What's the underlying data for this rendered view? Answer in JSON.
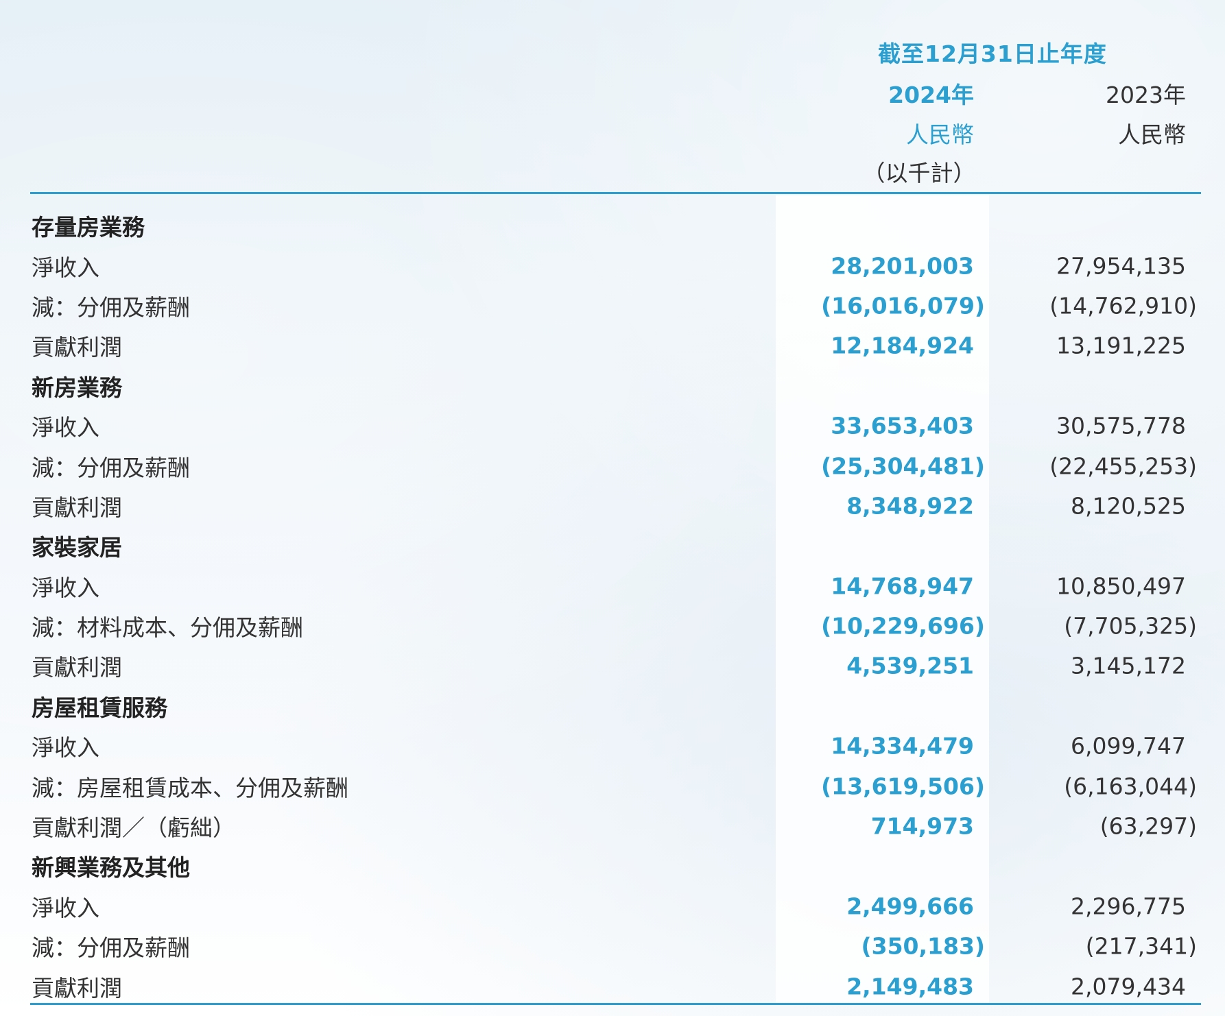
{
  "header": {
    "period": "截至12月31日止年度",
    "year_2024": "2024年",
    "year_2023": "2023年",
    "currency_2024": "人民幣",
    "currency_2023": "人民幣",
    "unit": "（以千計）"
  },
  "colors": {
    "accent": "#2c9fd1",
    "text": "#333333"
  },
  "rows": [
    {
      "label": "存量房業務",
      "section": true,
      "v2024": "",
      "v2023": ""
    },
    {
      "label": "淨收入",
      "section": false,
      "v2024": "28,201,003",
      "v2023": "27,954,135"
    },
    {
      "label": "減：分佣及薪酬",
      "section": false,
      "v2024": "(16,016,079)",
      "v2023": "(14,762,910)"
    },
    {
      "label": "貢獻利潤",
      "section": false,
      "v2024": "12,184,924",
      "v2023": "13,191,225"
    },
    {
      "label": "新房業務",
      "section": true,
      "v2024": "",
      "v2023": ""
    },
    {
      "label": "淨收入",
      "section": false,
      "v2024": "33,653,403",
      "v2023": "30,575,778"
    },
    {
      "label": "減：分佣及薪酬",
      "section": false,
      "v2024": "(25,304,481)",
      "v2023": "(22,455,253)"
    },
    {
      "label": "貢獻利潤",
      "section": false,
      "v2024": "8,348,922",
      "v2023": "8,120,525"
    },
    {
      "label": "家裝家居",
      "section": true,
      "v2024": "",
      "v2023": ""
    },
    {
      "label": "淨收入",
      "section": false,
      "v2024": "14,768,947",
      "v2023": "10,850,497"
    },
    {
      "label": "減：材料成本、分佣及薪酬",
      "section": false,
      "v2024": "(10,229,696)",
      "v2023": "(7,705,325)"
    },
    {
      "label": "貢獻利潤",
      "section": false,
      "v2024": "4,539,251",
      "v2023": "3,145,172"
    },
    {
      "label": "房屋租賃服務",
      "section": true,
      "v2024": "",
      "v2023": ""
    },
    {
      "label": "淨收入",
      "section": false,
      "v2024": "14,334,479",
      "v2023": "6,099,747"
    },
    {
      "label": "減：房屋租賃成本、分佣及薪酬",
      "section": false,
      "v2024": "(13,619,506)",
      "v2023": "(6,163,044)"
    },
    {
      "label": "貢獻利潤／（虧絀）",
      "section": false,
      "v2024": "714,973",
      "v2023": "(63,297)"
    },
    {
      "label": "新興業務及其他",
      "section": true,
      "v2024": "",
      "v2023": ""
    },
    {
      "label": "淨收入",
      "section": false,
      "v2024": "2,499,666",
      "v2023": "2,296,775"
    },
    {
      "label": "減：分佣及薪酬",
      "section": false,
      "v2024": "(350,183)",
      "v2023": "(217,341)"
    },
    {
      "label": "貢獻利潤",
      "section": false,
      "v2024": "2,149,483",
      "v2023": "2,079,434"
    }
  ]
}
